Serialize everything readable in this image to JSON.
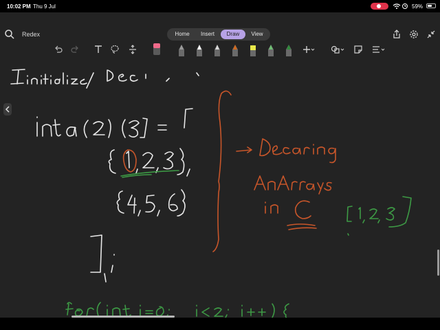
{
  "status_bar": {
    "time": "10:02 PM",
    "date": "Thu 9 Jul",
    "battery_percent": "59%",
    "battery_level": 0.59
  },
  "toolbar": {
    "document_title": "Redex",
    "tabs": [
      {
        "label": "Home",
        "active": false
      },
      {
        "label": "Insert",
        "active": false
      },
      {
        "label": "Draw",
        "active": true
      },
      {
        "label": "View",
        "active": false
      }
    ]
  },
  "draw_tools": {
    "pens": [
      {
        "name": "pen-1",
        "color": "#9a9a9a"
      },
      {
        "name": "pen-2",
        "color": "#ffffff"
      },
      {
        "name": "pen-3",
        "color": "#d9d9d9"
      },
      {
        "name": "pen-4",
        "color": "#d2691e"
      },
      {
        "name": "highlighter",
        "color": "#e8e84a"
      },
      {
        "name": "pen-6",
        "color": "#6fbf73"
      },
      {
        "name": "pen-7",
        "color": "#2e8b3a"
      }
    ],
    "highlight_color": "#b7a2e6",
    "eraser_color": "#f06a8a"
  },
  "ink_colors": {
    "white": "#e8e8e8",
    "orange": "#c8562a",
    "green": "#3d9a45"
  },
  "canvas_icons": [
    "back-chevron-icon",
    "undo-icon",
    "redo-icon",
    "text-icon",
    "lasso-icon",
    "insert-space-icon",
    "eraser-icon",
    "add-icon",
    "shapes-icon",
    "sticky-note-icon",
    "ink-to-shape-icon",
    "share-icon",
    "settings-icon",
    "collapse-icon"
  ]
}
